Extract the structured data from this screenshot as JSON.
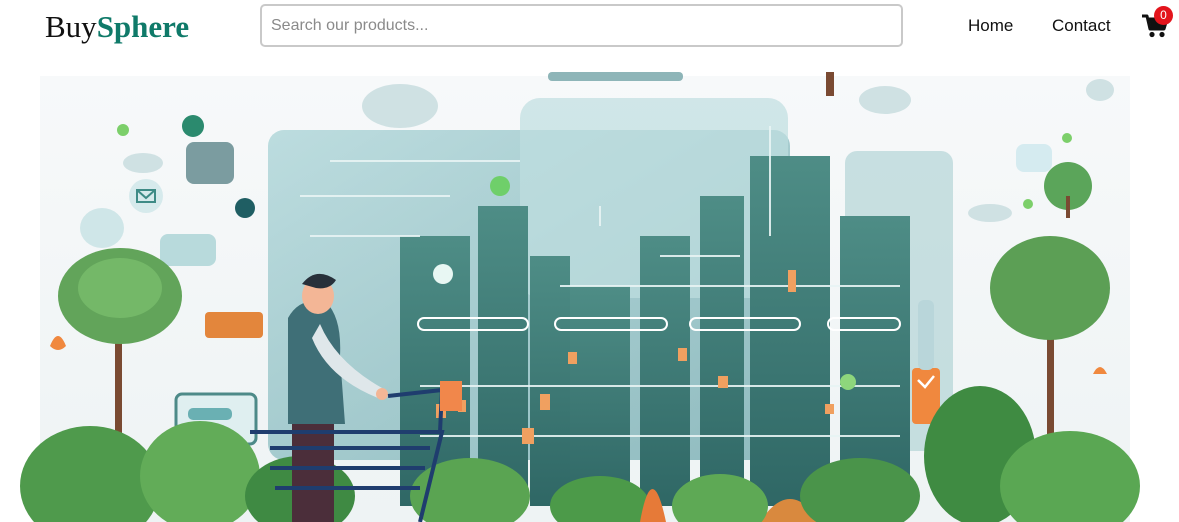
{
  "navbar": {
    "logo": {
      "part1": "Buy",
      "part2": "Sphere"
    },
    "search": {
      "placeholder": "Search our products...",
      "value": ""
    },
    "links": [
      {
        "label": "Home"
      },
      {
        "label": "Contact"
      }
    ],
    "cart": {
      "icon": "shopping-cart-icon",
      "count": "0"
    }
  },
  "hero": {
    "image": "illustration of a man pushing a shopping cart in front of a digital city interface",
    "card_label": "",
    "colors": {
      "accent": "#0f7a69",
      "badge": "#e3141c",
      "orange": "#f0883e"
    }
  }
}
